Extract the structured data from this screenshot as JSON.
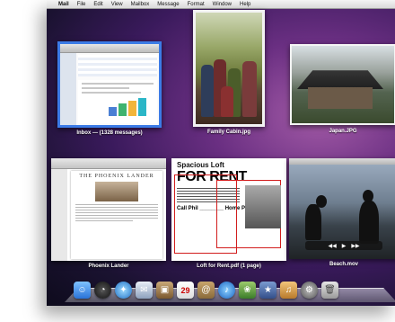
{
  "menubar": {
    "apple": "",
    "items": [
      "Mail",
      "File",
      "Edit",
      "View",
      "Mailbox",
      "Message",
      "Format",
      "Window",
      "Help"
    ]
  },
  "windows": {
    "mail": {
      "caption": "Inbox — (1328 messages)"
    },
    "family": {
      "caption": "Family Cabin.jpg"
    },
    "japan": {
      "caption": "Japan.JPG"
    },
    "phoenix": {
      "caption": "Phoenix Lander",
      "doc_title": "THE PHOENIX LANDER"
    },
    "rent": {
      "caption": "Loft for Rent.pdf (1 page)",
      "line1": "Spacious Loft",
      "line2": "FOR RENT",
      "call": "Call Phil ________ Home Phone"
    },
    "beach": {
      "caption": "Beach.mov"
    }
  },
  "dock": {
    "icons": [
      "finder-icon",
      "dashboard-icon",
      "safari-icon",
      "mail-icon",
      "photo-icon",
      "calendar-icon",
      "address-book-icon",
      "itunes-icon",
      "iphoto-icon",
      "imovie-icon",
      "garageband-icon",
      "system-preferences-icon",
      "trash-icon"
    ]
  },
  "colors": {
    "selection": "#3c7be6",
    "desktop": "#6a2f82"
  }
}
